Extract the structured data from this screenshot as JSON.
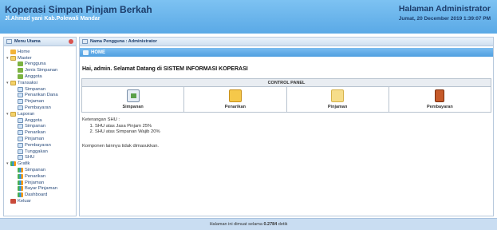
{
  "header": {
    "title": "Koperasi Simpan Pinjam Berkah",
    "address": "Jl.Ahmad yani Kab.Polewali Mandar",
    "admin_title": "Halaman Administrator",
    "date": "Jumat, 20 December 2019 1:39:07 PM"
  },
  "sidebar": {
    "title": "Menu Utama",
    "items": [
      {
        "label": "Home",
        "icon": "home-icon",
        "indent": 0,
        "toggle": ""
      },
      {
        "label": "Master",
        "icon": "folder-icon",
        "indent": 0,
        "toggle": "▾"
      },
      {
        "label": "Pengguna",
        "icon": "user-icon",
        "indent": 1,
        "toggle": ""
      },
      {
        "label": "Jenis Simpanan",
        "icon": "user-icon",
        "indent": 1,
        "toggle": ""
      },
      {
        "label": "Anggota",
        "icon": "user-icon",
        "indent": 1,
        "toggle": ""
      },
      {
        "label": "Transaksi",
        "icon": "folder-icon",
        "indent": 0,
        "toggle": "▾"
      },
      {
        "label": "Simpanan",
        "icon": "doc-icon",
        "indent": 1,
        "toggle": ""
      },
      {
        "label": "Penarikan Dana",
        "icon": "doc-icon",
        "indent": 1,
        "toggle": ""
      },
      {
        "label": "Pinjaman",
        "icon": "doc-icon",
        "indent": 1,
        "toggle": ""
      },
      {
        "label": "Pembayaran",
        "icon": "doc-icon",
        "indent": 1,
        "toggle": ""
      },
      {
        "label": "Laporan",
        "icon": "folder-icon",
        "indent": 0,
        "toggle": "▾"
      },
      {
        "label": "Anggota",
        "icon": "doc-icon",
        "indent": 1,
        "toggle": ""
      },
      {
        "label": "Simpanan",
        "icon": "doc-icon",
        "indent": 1,
        "toggle": ""
      },
      {
        "label": "Penarikan",
        "icon": "doc-icon",
        "indent": 1,
        "toggle": ""
      },
      {
        "label": "Pinjaman",
        "icon": "doc-icon",
        "indent": 1,
        "toggle": ""
      },
      {
        "label": "Pembayaran",
        "icon": "doc-icon",
        "indent": 1,
        "toggle": ""
      },
      {
        "label": "Tunggakan",
        "icon": "doc-icon",
        "indent": 1,
        "toggle": ""
      },
      {
        "label": "SHU",
        "icon": "doc-icon",
        "indent": 1,
        "toggle": ""
      },
      {
        "label": "Grafik",
        "icon": "chart-icon",
        "indent": 0,
        "toggle": "▾"
      },
      {
        "label": "Simpanan",
        "icon": "chart-icon",
        "indent": 1,
        "toggle": ""
      },
      {
        "label": "Penarikan",
        "icon": "chart-icon",
        "indent": 1,
        "toggle": ""
      },
      {
        "label": "Pinjaman",
        "icon": "chart-icon",
        "indent": 1,
        "toggle": ""
      },
      {
        "label": "Bayar Pinjaman",
        "icon": "chart-icon",
        "indent": 1,
        "toggle": ""
      },
      {
        "label": "Dashboard",
        "icon": "chart-icon",
        "indent": 1,
        "toggle": ""
      },
      {
        "label": "Keluar",
        "icon": "book-icon",
        "indent": 0,
        "toggle": ""
      }
    ]
  },
  "main": {
    "user_label": "Nama Pengguna : Administrator",
    "home_label": "HOME",
    "welcome": "Hai, admin. Selamat Datang di SISTEM INFORMASI KOPERASI",
    "control_panel": {
      "title": "CONTROL PANEL",
      "items": [
        {
          "label": "Simpanan",
          "icon": "cash-register-icon"
        },
        {
          "label": "Penarikan",
          "icon": "envelope-icon"
        },
        {
          "label": "Pinjaman",
          "icon": "folder-open-icon"
        },
        {
          "label": "Pembayaran",
          "icon": "ledger-book-icon"
        }
      ]
    },
    "keterangan_title": "Keterangan SHU :",
    "keterangan_items": [
      "SHU atas Jasa Pinjam 25%",
      "SHU atas Simpanan Wajib 20%"
    ],
    "note": "Komponen lainnya tidak dimasukkan."
  },
  "footer": {
    "prefix": "Halaman ini dimuat selama",
    "time": "0.2784",
    "suffix": "detik"
  }
}
